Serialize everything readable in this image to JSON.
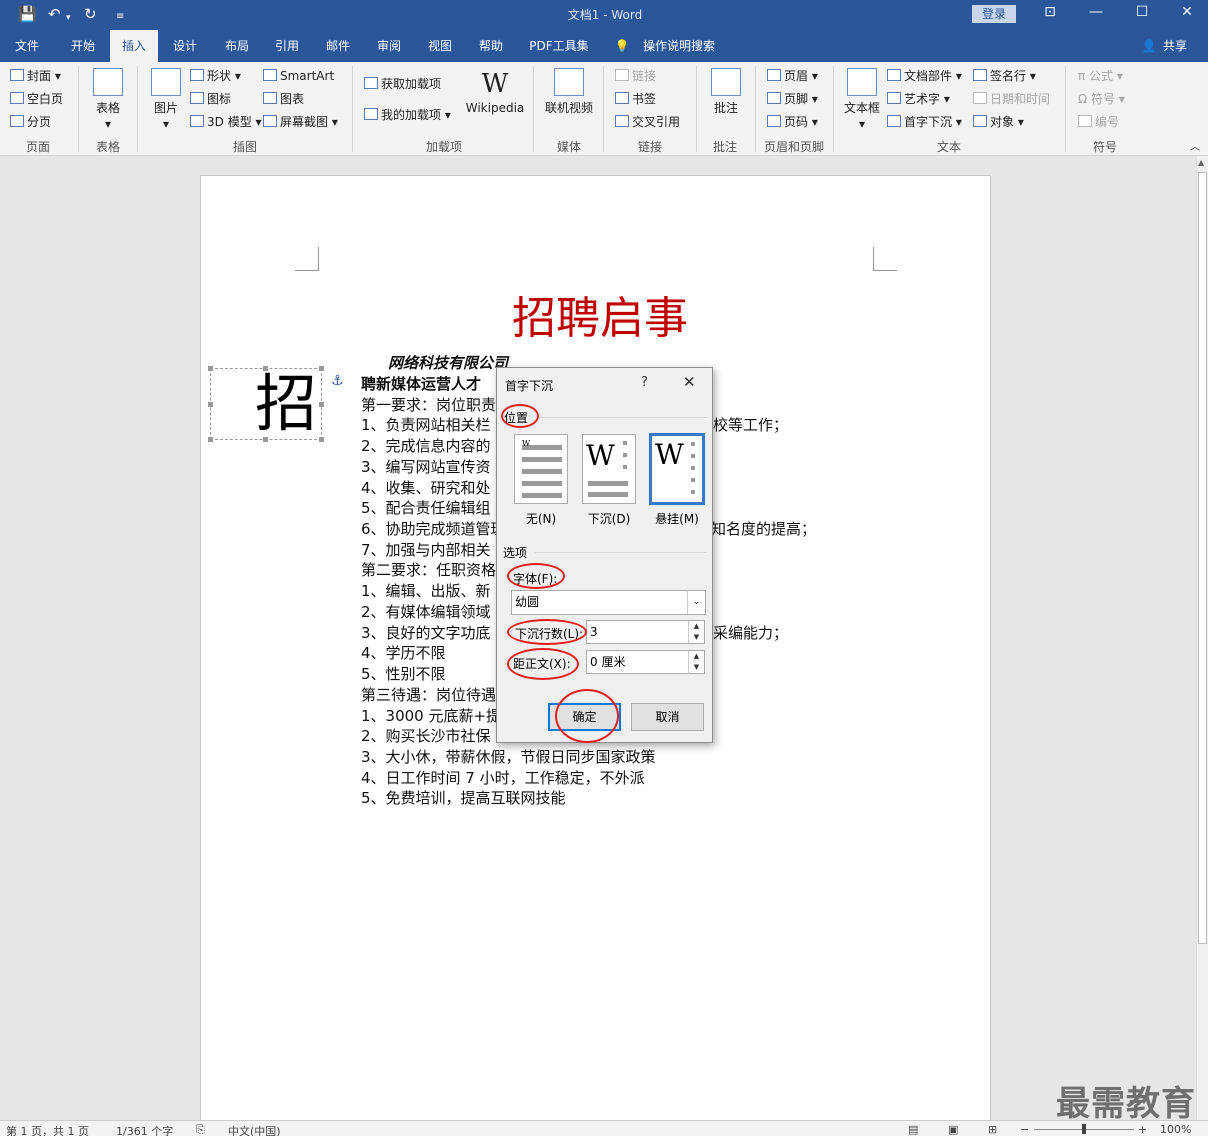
{
  "window": {
    "title": "文档1  -  Word",
    "login": "登录",
    "share": "共享"
  },
  "menu": [
    "文件",
    "开始",
    "插入",
    "设计",
    "布局",
    "引用",
    "邮件",
    "审阅",
    "视图",
    "帮助",
    "PDF工具集",
    "操作说明搜索"
  ],
  "ribbon": {
    "pages": [
      "封面",
      "空白页",
      "分页"
    ],
    "table": "表格",
    "picture": "图片",
    "illus": [
      "形状",
      "图标",
      "3D 模型",
      "SmartArt",
      "图表",
      "屏幕截图"
    ],
    "addins": [
      "获取加载项",
      "我的加载项",
      "Wikipedia"
    ],
    "media": "联机视频",
    "links": [
      "链接",
      "书签",
      "交叉引用"
    ],
    "comment": "批注",
    "hf": [
      "页眉",
      "页脚",
      "页码"
    ],
    "textbox": "文本框",
    "text": [
      "文档部件",
      "艺术字",
      "首字下沉",
      "签名行",
      "日期和时间",
      "对象"
    ],
    "symbols": [
      "公式",
      "符号",
      "编号"
    ],
    "groups": [
      "页面",
      "表格",
      "插图",
      "加载项",
      "媒体",
      "链接",
      "批注",
      "页眉和页脚",
      "文本",
      "符号"
    ]
  },
  "doc": {
    "title": "招聘启事",
    "dropcap": "招",
    "company": "网络科技有限公司",
    "lines": [
      {
        "left": "聘新媒体运营人才",
        "right": ""
      },
      {
        "left": "第一要求：岗位职责",
        "right": ""
      },
      {
        "left": "1、负责网站相关栏",
        "right": "校等工作；"
      },
      {
        "left": "2、完成信息内容的",
        "right": ""
      },
      {
        "left": "3、编写网站宣传资",
        "right": ""
      },
      {
        "left": "4、收集、研究和处",
        "right": ""
      },
      {
        "left": "5、配合责任编辑组",
        "right": ""
      },
      {
        "left": "6、协助完成频道管理",
        "right": "知名度的提高；"
      },
      {
        "left": "7、加强与内部相关",
        "right": ""
      },
      {
        "left": "第二要求：任职资格",
        "right": ""
      },
      {
        "left": "1、编辑、出版、新",
        "right": ""
      },
      {
        "left": "2、有媒体编辑领域",
        "right": ""
      },
      {
        "left": "3、良好的文字功底",
        "right": "采编能力；"
      },
      {
        "left": "4、学历不限",
        "right": ""
      },
      {
        "left": "5、性别不限",
        "right": ""
      },
      {
        "left": "第三待遇：岗位待遇",
        "right": ""
      },
      {
        "left": "1、3000 元底薪+提成",
        "right": ""
      },
      {
        "left": "2、购买长沙市社保",
        "right": ""
      },
      {
        "left": "3、大小休，带薪休假，节假日同步国家政策",
        "right": ""
      },
      {
        "left": "4、日工作时间 7 小时，工作稳定，不外派",
        "right": ""
      },
      {
        "left": "5、免费培训，提高互联网技能",
        "right": ""
      }
    ]
  },
  "dialog": {
    "title": "首字下沉",
    "help": "?",
    "close": "✕",
    "position_label": "位置",
    "options": [
      "无(N)",
      "下沉(D)",
      "悬挂(M)"
    ],
    "options_section": "选项",
    "font_label": "字体(F):",
    "font_value": "幼圆",
    "lines_label": "下沉行数(L):",
    "lines_value": "3",
    "distance_label": "距正文(X):",
    "distance_value": "0 厘米",
    "ok": "确定",
    "cancel": "取消"
  },
  "status": {
    "page": "第 1 页，共 1 页",
    "words": "1/361 个字",
    "lang": "中文(中国)",
    "zoom": "100%"
  },
  "watermark": "最需教育"
}
